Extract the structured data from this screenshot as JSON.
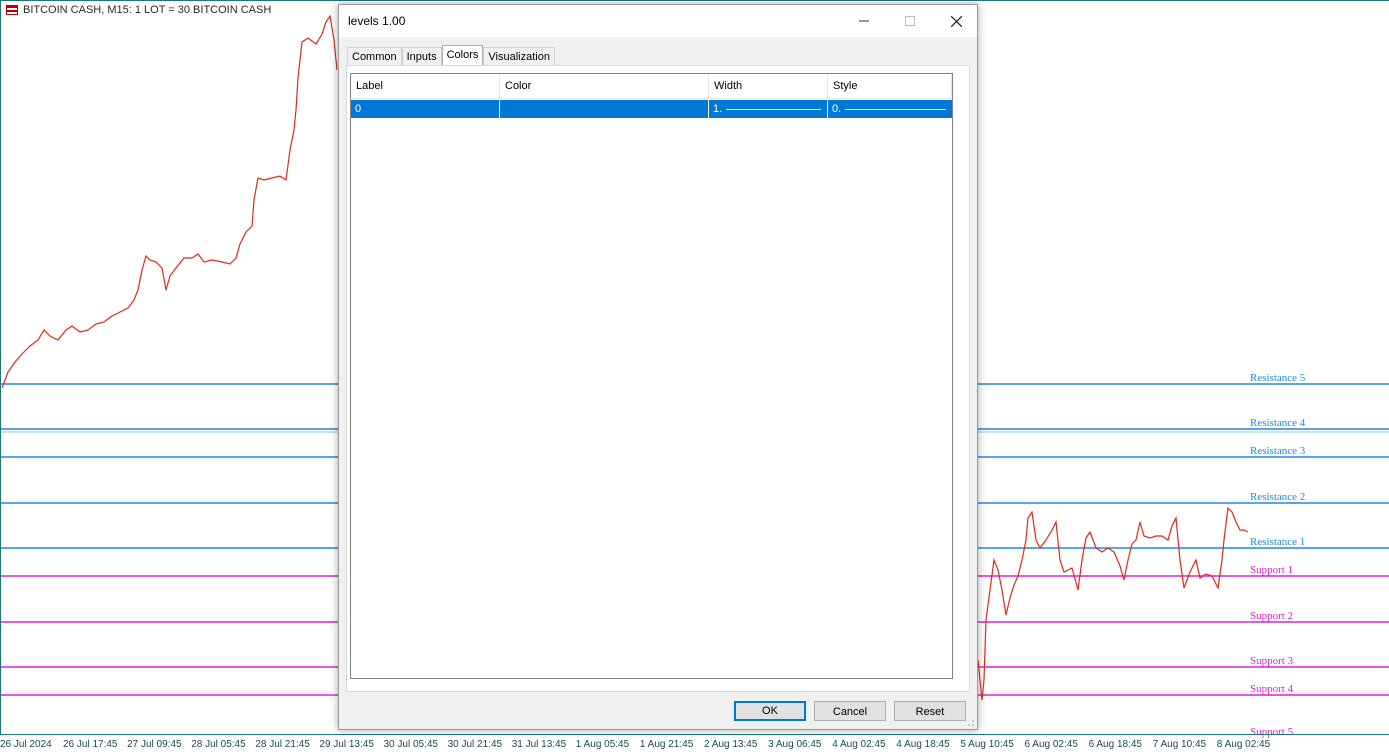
{
  "chart": {
    "title": "BITCOIN CASH, M15:  1 LOT = 30 BITCOIN CASH",
    "time_axis": [
      "26 Jul 2024",
      "26 Jul 17:45",
      "27 Jul 09:45",
      "28 Jul 05:45",
      "28 Jul 21:45",
      "29 Jul 13:45",
      "30 Jul 05:45",
      "30 Jul 21:45",
      "31 Jul 13:45",
      "1 Aug 05:45",
      "1 Aug 21:45",
      "2 Aug 13:45",
      "3 Aug 06:45",
      "4 Aug 02:45",
      "4 Aug 18:45",
      "5 Aug 10:45",
      "6 Aug 02:45",
      "6 Aug 18:45",
      "7 Aug 10:45",
      "8 Aug 02:45"
    ],
    "levels": [
      {
        "label": "Resistance 5",
        "color": "#1e88e5"
      },
      {
        "label": "Resistance 4",
        "color": "#1e88e5"
      },
      {
        "label": "Resistance 3",
        "color": "#1e88e5"
      },
      {
        "label": "Resistance 2",
        "color": "#1e88e5"
      },
      {
        "label": "Resistance 1",
        "color": "#1e88e5"
      },
      {
        "label": "Support 1",
        "color": "#e020e0"
      },
      {
        "label": "Support 2",
        "color": "#e020e0"
      },
      {
        "label": "Support 3",
        "color": "#e020e0"
      },
      {
        "label": "Support 4",
        "color": "#e020e0"
      },
      {
        "label": "Support 5",
        "color": "#e020e0"
      }
    ],
    "price_color": "#e8261a"
  },
  "dialog": {
    "title": "levels 1.00",
    "tabs": [
      "Common",
      "Inputs",
      "Colors",
      "Visualization"
    ],
    "active_tab": "Colors",
    "columns": [
      "Label",
      "Color",
      "Width",
      "Style"
    ],
    "rows": [
      {
        "label": "0",
        "color": "",
        "width": "1.",
        "style": "0."
      }
    ],
    "buttons": {
      "ok": "OK",
      "cancel": "Cancel",
      "reset": "Reset"
    }
  }
}
